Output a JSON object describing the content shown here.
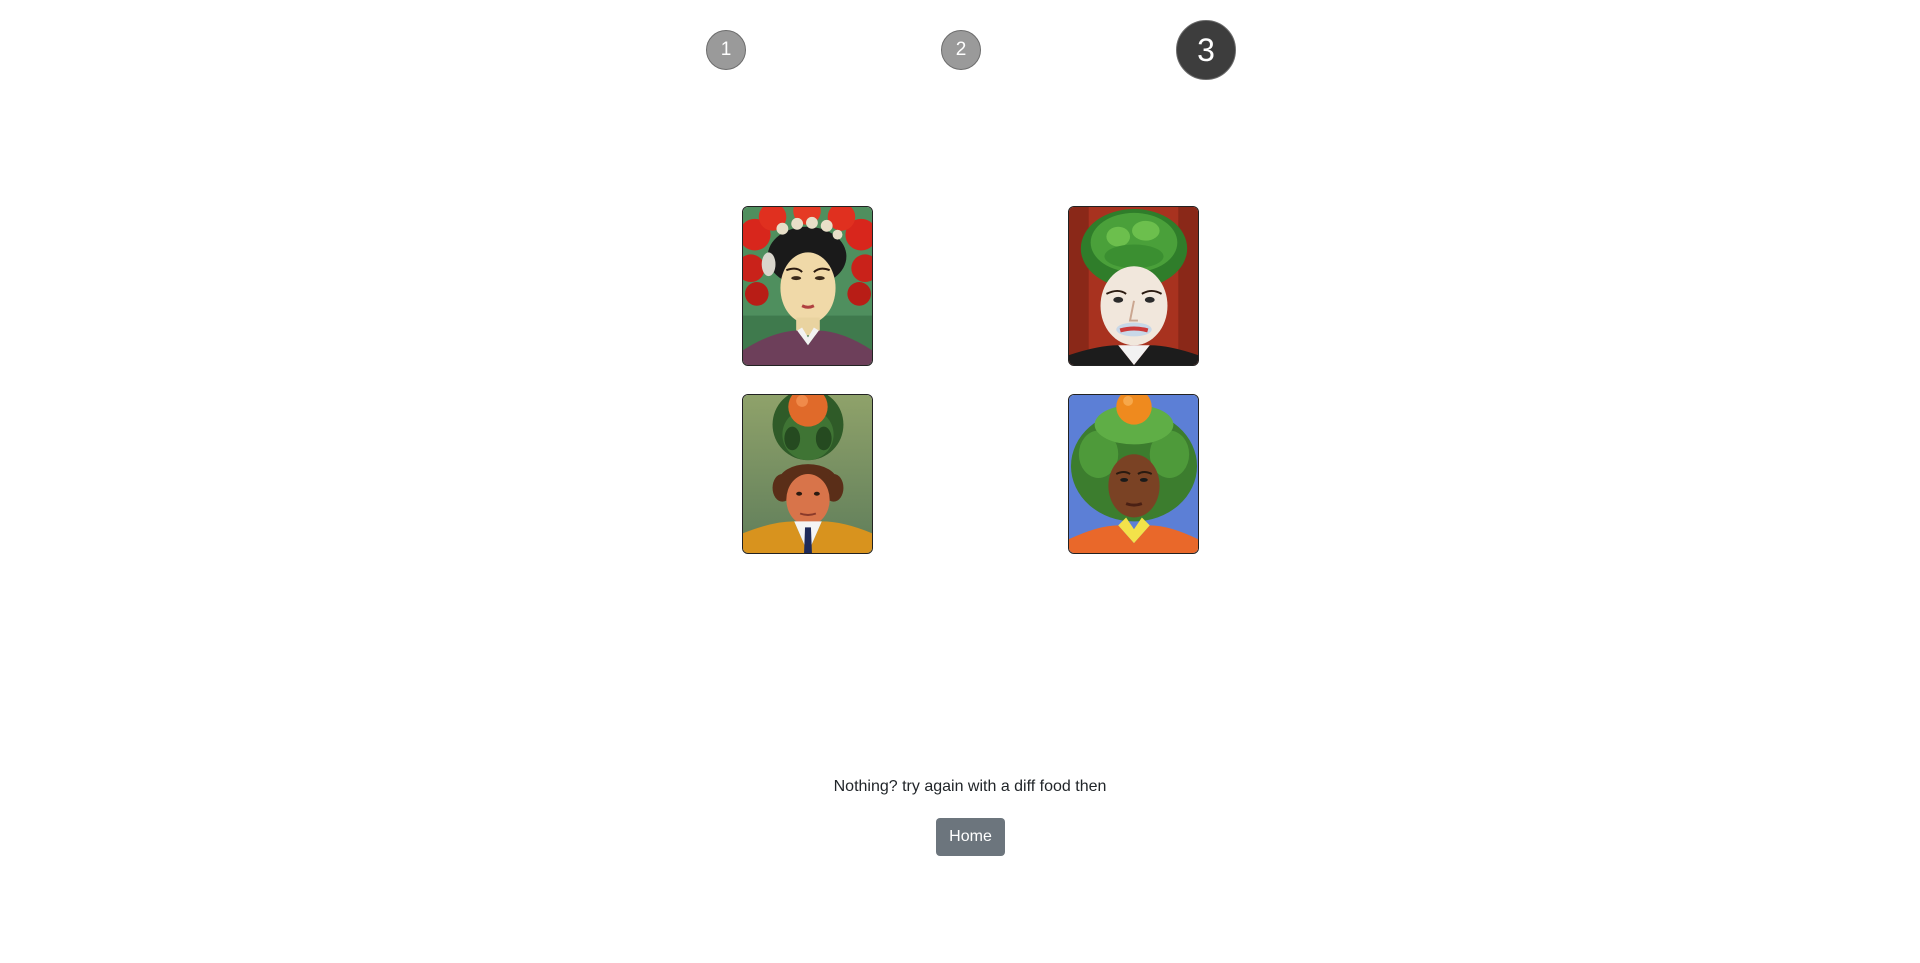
{
  "steps": [
    {
      "label": "1",
      "state": "inactive"
    },
    {
      "label": "2",
      "state": "inactive"
    },
    {
      "label": "3",
      "state": "active"
    }
  ],
  "colors": {
    "step_inactive": "#9a9a9a",
    "step_active": "#3d3d3d",
    "home_button": "#6c757d"
  },
  "portraits": [
    {
      "icon": "portrait-woman-red-flowers-icon"
    },
    {
      "icon": "portrait-man-broccoli-hair-icon"
    },
    {
      "icon": "portrait-man-orange-leaves-icon"
    },
    {
      "icon": "portrait-man-green-afro-orange-icon"
    }
  ],
  "footer": {
    "message": "Nothing? try again with a diff food then",
    "home_label": "Home"
  }
}
